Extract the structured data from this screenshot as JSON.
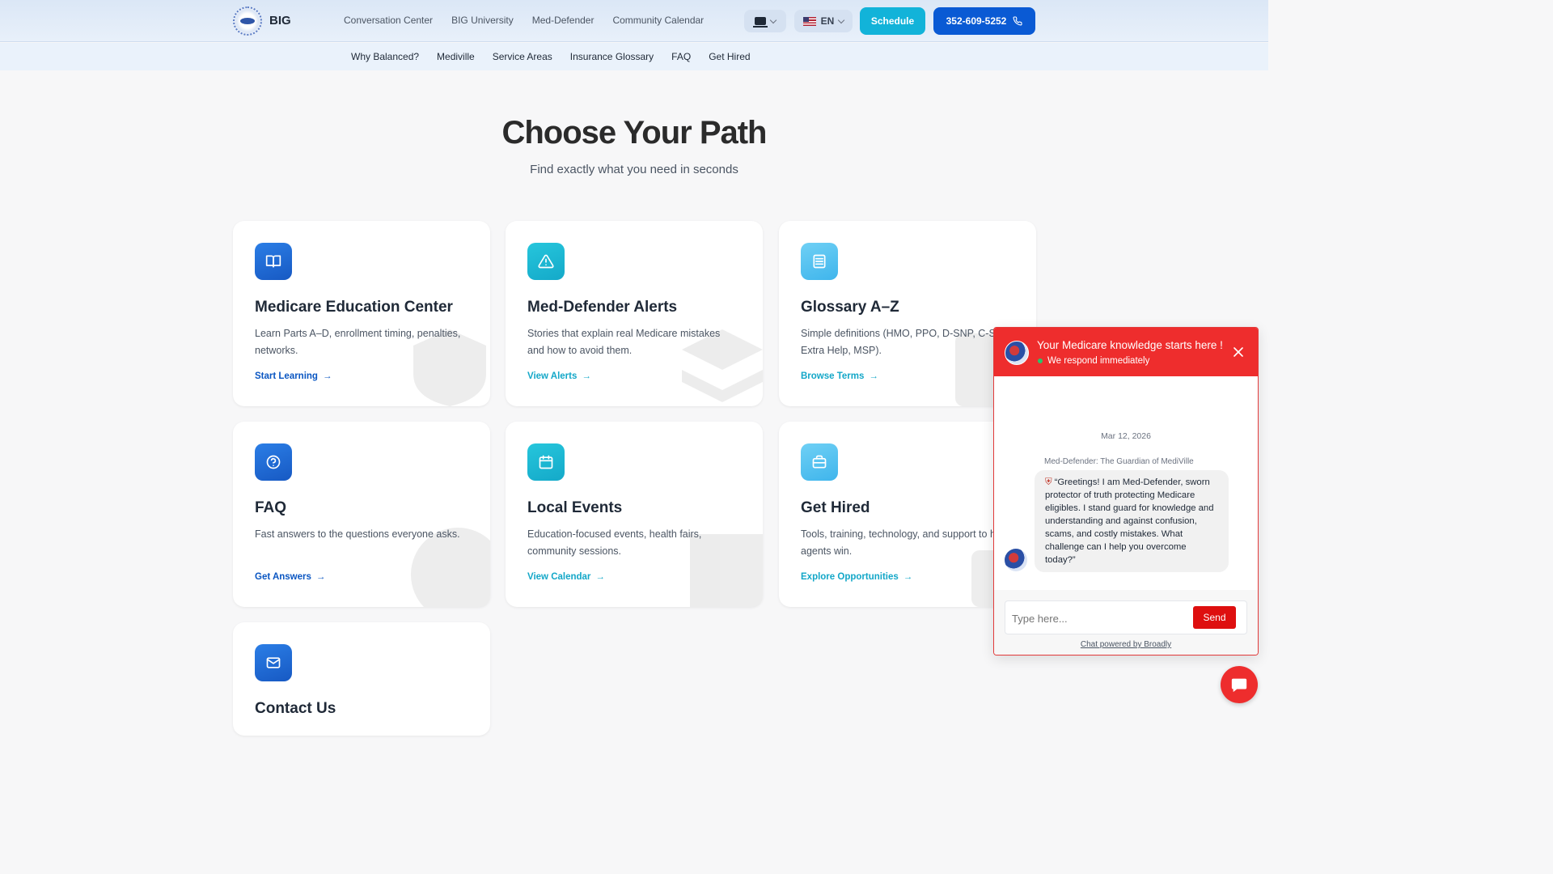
{
  "header": {
    "brand": "BIG",
    "nav": [
      "Conversation Center",
      "BIG University",
      "Med-Defender",
      "Community Calendar"
    ],
    "language": "EN",
    "schedule_label": "Schedule",
    "phone_label": "352-609-5252"
  },
  "subnav": [
    "Why Balanced?",
    "Mediville",
    "Service Areas",
    "Insurance Glossary",
    "FAQ",
    "Get Hired"
  ],
  "hero": {
    "title": "Choose Your Path",
    "subtitle": "Find exactly what you need in seconds"
  },
  "cards": [
    {
      "title": "Medicare Education Center",
      "desc": "Learn Parts A–D, enrollment timing, penalties, networks.",
      "link": "Start Learning",
      "icon": "book-icon"
    },
    {
      "title": "Med-Defender Alerts",
      "desc": "Stories that explain real Medicare mistakes and how to avoid them.",
      "link": "View Alerts",
      "icon": "alert-triangle-icon"
    },
    {
      "title": "Glossary A–Z",
      "desc": "Simple definitions (HMO, PPO, D-SNP, C-SNP, Extra Help, MSP).",
      "link": "Browse Terms",
      "icon": "list-icon"
    },
    {
      "title": "FAQ",
      "desc": "Fast answers to the questions everyone asks.",
      "link": "Get Answers",
      "icon": "question-icon"
    },
    {
      "title": "Local Events",
      "desc": "Education-focused events, health fairs, community sessions.",
      "link": "View Calendar",
      "icon": "calendar-icon"
    },
    {
      "title": "Get Hired",
      "desc": "Tools, training, technology, and support to help agents win.",
      "link": "Explore Opportunities",
      "icon": "briefcase-icon"
    },
    {
      "title": "Contact Us",
      "desc": "",
      "link": "",
      "icon": "mail-icon"
    }
  ],
  "chat": {
    "title": "Your Medicare knowledge starts here !",
    "status": "We respond immediately",
    "date": "Mar 12, 2026",
    "sender": "Med-Defender: The Guardian of MediVille",
    "message": "“Greetings! I am Med-Defender, sworn protector of truth protecting Medicare eligibles. I stand guard for knowledge and understanding and against confusion, scams, and costly mistakes. What challenge can I help you overcome today?”",
    "placeholder": "Type here...",
    "send_label": "Send",
    "powered": "Chat powered by Broadly"
  },
  "colors": {
    "accent_blue": "#0a5ad4",
    "accent_teal": "#12b3d9",
    "chat_red": "#ee2d2d"
  }
}
